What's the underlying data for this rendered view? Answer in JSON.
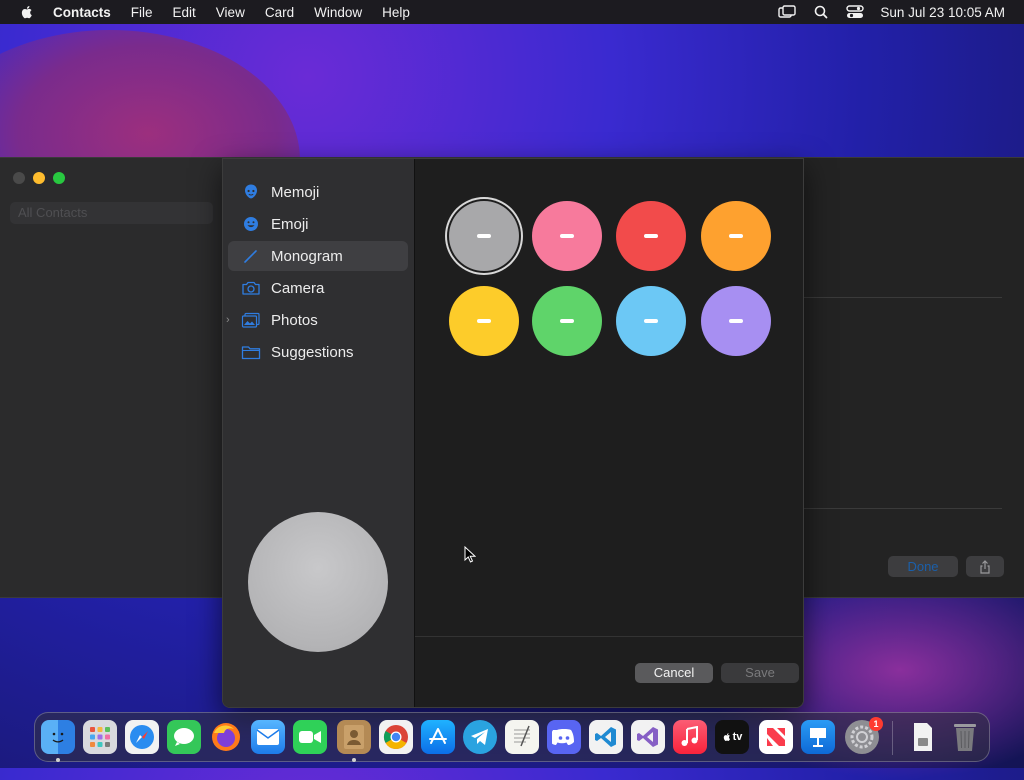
{
  "menubar": {
    "items": [
      "Contacts",
      "File",
      "Edit",
      "View",
      "Card",
      "Window",
      "Help"
    ],
    "clock": "Sun Jul 23  10:05 AM"
  },
  "contacts_window": {
    "sidebar_group": "All Contacts",
    "done_label": "Done"
  },
  "sheet": {
    "sources": [
      {
        "label": "Memoji",
        "icon": "memoji-icon"
      },
      {
        "label": "Emoji",
        "icon": "emoji-icon"
      },
      {
        "label": "Monogram",
        "icon": "pencil-icon",
        "selected": true
      },
      {
        "label": "Camera",
        "icon": "camera-icon"
      },
      {
        "label": "Photos",
        "icon": "photos-icon"
      },
      {
        "label": "Suggestions",
        "icon": "folder-icon"
      }
    ],
    "swatch_colors": [
      "#a8a8aa",
      "#f77a9c",
      "#f24b4b",
      "#fea12f",
      "#fdcc2a",
      "#5fd46a",
      "#6cc8f5",
      "#a78ff2"
    ],
    "selected_swatch": 0,
    "cancel_label": "Cancel",
    "save_label": "Save"
  },
  "accent_color": "#2f7de1",
  "dock": {
    "apps": [
      "finder",
      "launchpad",
      "safari",
      "messages",
      "firefox",
      "mail",
      "facetime",
      "contacts",
      "chrome",
      "app-store",
      "telegram",
      "textedit",
      "discord",
      "vscode",
      "visual-studio",
      "music",
      "apple-tv",
      "news",
      "keynote",
      "system-settings",
      "disk-image",
      "trash"
    ],
    "settings_badge": "1",
    "tv_label": "tv"
  }
}
